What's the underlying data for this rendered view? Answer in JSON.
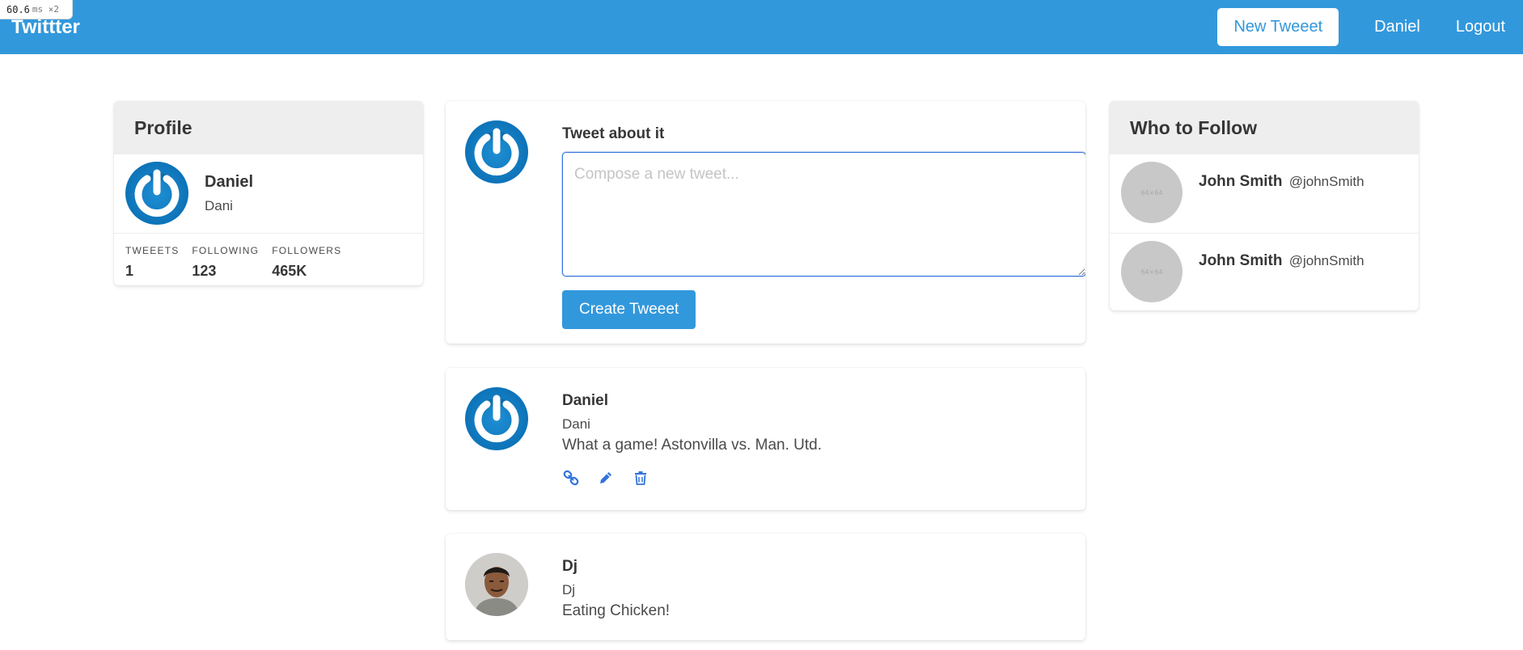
{
  "perf": {
    "value": "60.6",
    "unit": "ms ×2"
  },
  "navbar": {
    "brand": "Twittter",
    "new_tweet": "New Tweeet",
    "user": "Daniel",
    "logout": "Logout"
  },
  "profile": {
    "header": "Profile",
    "name": "Daniel",
    "handle": "Dani",
    "stats": [
      {
        "label": "TWEEETS",
        "value": "1"
      },
      {
        "label": "FOLLOWING",
        "value": "123"
      },
      {
        "label": "FOLLOWERS",
        "value": "465K"
      }
    ]
  },
  "compose": {
    "label": "Tweet about it",
    "placeholder": "Compose a new tweet...",
    "button": "Create Tweeet"
  },
  "tweets": [
    {
      "name": "Daniel",
      "handle": "Dani",
      "text": "What a game! Astonvilla vs. Man. Utd.",
      "avatar": "power-icon",
      "actions": [
        "link-icon",
        "pencil-icon",
        "trash-icon"
      ]
    },
    {
      "name": "Dj",
      "handle": "Dj",
      "text": "Eating Chicken!",
      "avatar": "photo"
    }
  ],
  "who_to_follow": {
    "header": "Who to Follow",
    "items": [
      {
        "name": "John Smith",
        "handle": "@johnSmith",
        "placeholder": "64×64"
      },
      {
        "name": "John Smith",
        "handle": "@johnSmith",
        "placeholder": "64×64"
      }
    ]
  },
  "colors": {
    "primary": "#3298dc",
    "avatar_blue": "#0d73b8",
    "action_icon": "#3273dc"
  }
}
